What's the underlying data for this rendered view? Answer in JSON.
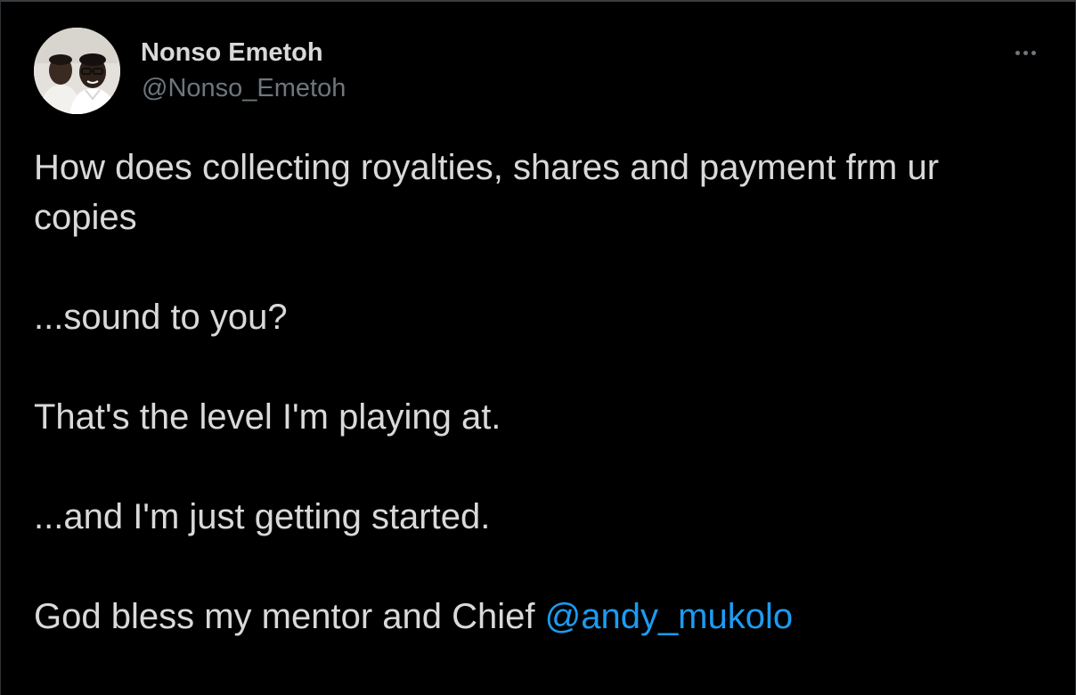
{
  "tweet": {
    "author": {
      "display_name": "Nonso Emetoh",
      "handle": "@Nonso_Emetoh"
    },
    "text": {
      "line1": "How does collecting royalties, shares and payment frm ur copies",
      "line2": "...sound to you?",
      "line3": "That's the level I'm playing at.",
      "line4": "...and I'm just getting started.",
      "line5_prefix": "God bless my mentor and Chief ",
      "line5_mention": "@andy_mukolo"
    }
  },
  "colors": {
    "background": "#000000",
    "text_primary": "#d9d9d9",
    "text_secondary": "#6e767d",
    "link": "#1d9bf0"
  },
  "icons": {
    "more": "more-horizontal-icon",
    "avatar": "profile-photo"
  }
}
